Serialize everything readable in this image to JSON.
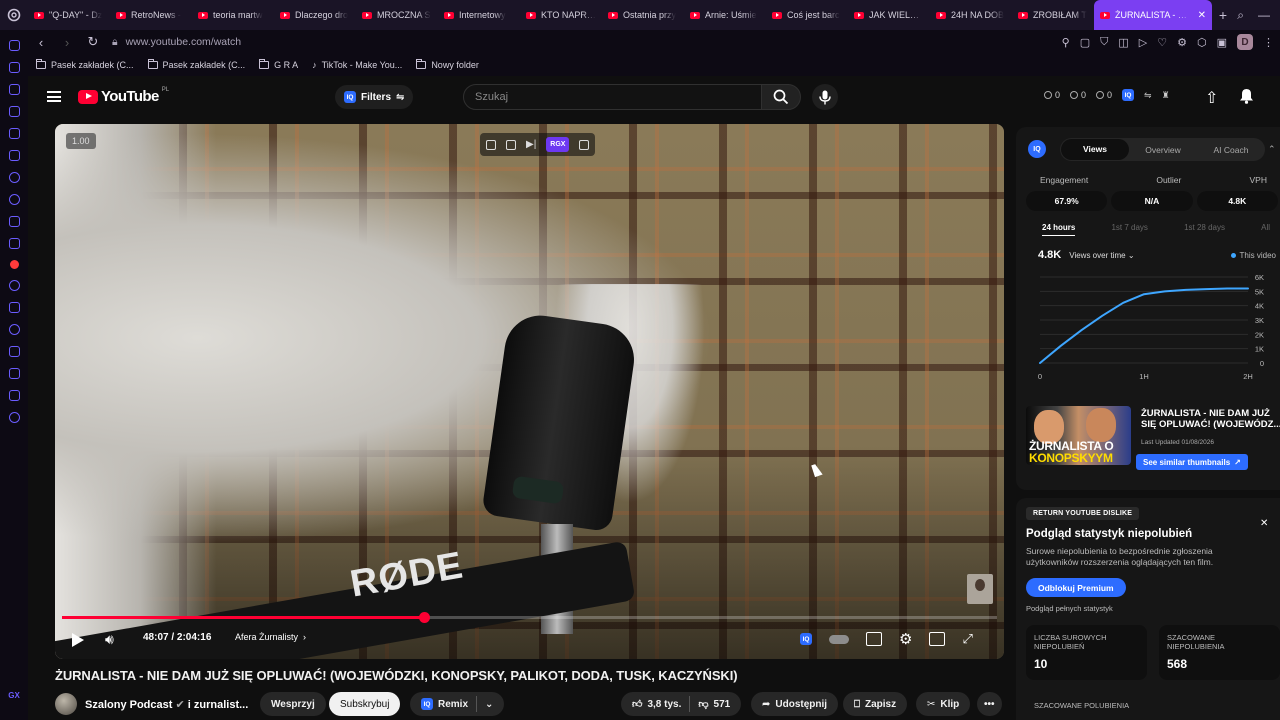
{
  "browser": {
    "tabs": [
      {
        "label": "\"Q-DAY\" - Dz"
      },
      {
        "label": "RetroNews -"
      },
      {
        "label": "teoria martw"
      },
      {
        "label": "Dlaczego dro"
      },
      {
        "label": "MROCZNA S"
      },
      {
        "label": "Internetowy"
      },
      {
        "label": "KTO NAPRAW"
      },
      {
        "label": "Ostatnia przy"
      },
      {
        "label": "Arnie: Uśmie"
      },
      {
        "label": "Coś jest barc"
      },
      {
        "label": "JAK WIELKIE"
      },
      {
        "label": "24H NA DOB"
      },
      {
        "label": "ZROBIŁAM T"
      }
    ],
    "active_tab": "ŻURNALISTA - NIE DAM",
    "url": "www.youtube.com/watch",
    "profile_letter": "D",
    "bookmarks": [
      {
        "label": "Pasek zakładek (C...",
        "icon": "folder-icon"
      },
      {
        "label": "Pasek zakładek (C...",
        "icon": "folder-icon"
      },
      {
        "label": "G R A",
        "icon": "folder-icon"
      },
      {
        "label": "TikTok - Make You...",
        "icon": "tiktok-icon"
      },
      {
        "label": "Nowy folder",
        "icon": "folder-icon"
      }
    ],
    "sidebar_label": "GX"
  },
  "header": {
    "logo_text": "YouTube",
    "region": "PL",
    "filters_label": "Filters",
    "iq_label": "IQ",
    "search_placeholder": "Szukaj",
    "stats": [
      "0",
      "0",
      "0"
    ]
  },
  "player": {
    "speed": "1.00",
    "rgx_label": "RGX",
    "rode_label": "RØDE",
    "time": "48:07 / 2:04:16",
    "chapter": "Afera Żurnalisty",
    "progress_fraction": 0.387
  },
  "video": {
    "title": "ŻURNALISTA - NIE DAM JUŻ SIĘ OPLUWAĆ! (WOJEWÓDZKI, KONOPSKY, PALIKOT, DODA, TUSK, KACZYŃSKI)",
    "channel": "Szalony Podcast",
    "channel_suffix": "i zurnalist...",
    "support_label": "Wesprzyj",
    "subscribe_label": "Subskrybuj",
    "remix_label": "Remix",
    "likes": "3,8 tys.",
    "dislikes": "571",
    "share_label": "Udostępnij",
    "save_label": "Zapisz",
    "clip_label": "Klip"
  },
  "iq_panel": {
    "tabs": [
      "Views",
      "Overview",
      "AI Coach"
    ],
    "metrics": [
      {
        "label": "Engagement",
        "value": "67.9%"
      },
      {
        "label": "Outlier",
        "value": "N/A"
      },
      {
        "label": "VPH",
        "value": "4.8K"
      }
    ],
    "ranges": [
      "24 hours",
      "1st 7 days",
      "1st 28 days",
      "All"
    ],
    "views_value": "4.8K",
    "views_selector": "Views over time",
    "legend_label": "This video"
  },
  "chart_data": {
    "type": "line",
    "title": "",
    "xlabel": "",
    "ylabel": "",
    "x_ticks": [
      "0",
      "1H",
      "2H"
    ],
    "y_ticks": [
      "0",
      "1K",
      "2K",
      "3K",
      "4K",
      "5K",
      "6K"
    ],
    "ylim": [
      0,
      6000
    ],
    "xlim": [
      0,
      2
    ],
    "series": [
      {
        "name": "This video",
        "color": "#3ea6ff",
        "x": [
          0,
          0.2,
          0.4,
          0.6,
          0.8,
          1.0,
          1.2,
          1.4,
          1.6,
          1.8,
          2.0
        ],
        "y": [
          0,
          1200,
          2300,
          3300,
          4200,
          4800,
          5000,
          5100,
          5150,
          5200,
          5200
        ]
      }
    ]
  },
  "thumb_card": {
    "title_line1": "ŻURNALISTA - NIE DAM JUŻ",
    "title_line2": "SIĘ OPLUWAĆ! (WOJEWÓDZ...",
    "thumb_text1": "ŻURNALISTA O",
    "thumb_text2": "KONOPSKYYM",
    "updated": "Last Updated 01/08/2026",
    "similar_label": "See similar thumbnails"
  },
  "dislike_panel": {
    "badge": "RETURN YOUTUBE DISLIKE",
    "title": "Podgląd statystyk niepolubień",
    "description": "Surowe niepolubienia to bezpośrednie zgłoszenia użytkowników rozszerzenia oglądających ten film.",
    "unlock_label": "Odblokuj Premium",
    "note": "Podgląd pełnych statystyk",
    "boxes": [
      {
        "label": "LICZBA SUROWYCH NIEPOLUBIEŃ",
        "value": "10"
      },
      {
        "label": "SZACOWANE NIEPOLUBIENIA",
        "value": "568"
      }
    ],
    "bottom_label": "SZACOWANE POLUBIENIA"
  }
}
